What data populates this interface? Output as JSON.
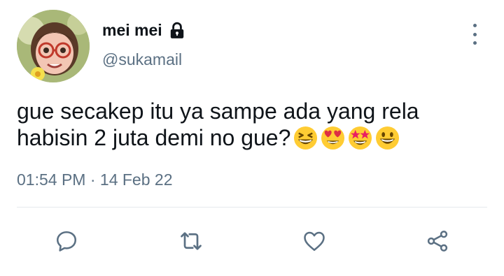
{
  "author": {
    "display_name": "mei mei",
    "handle": "@sukamail",
    "protected_icon": "lock-icon"
  },
  "tweet": {
    "text": "gue secakep itu ya sampe ada yang rela habisin 2 juta demi no gue?",
    "emojis": [
      "grinning-squinting-face",
      "smiling-face-with-heart-eyes",
      "star-struck",
      "grinning-face"
    ]
  },
  "meta": {
    "time": "01:54 PM",
    "separator": "·",
    "date": "14 Feb 22"
  },
  "actions": [
    {
      "icon": "reply-icon"
    },
    {
      "icon": "retweet-icon"
    },
    {
      "icon": "like-icon"
    },
    {
      "icon": "share-icon"
    }
  ],
  "colors": {
    "text_primary": "#0f1419",
    "text_secondary": "#5b7083",
    "divider": "#e6e9ec",
    "emoji_yellow": "#ffcc33"
  }
}
